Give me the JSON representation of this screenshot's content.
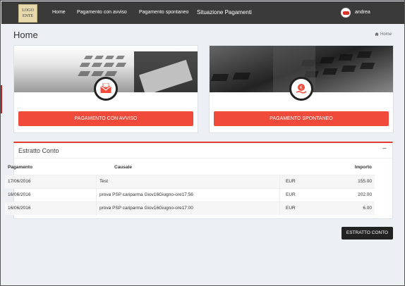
{
  "navbar": {
    "logo_line1": "LOGO",
    "logo_line2": "ENTE",
    "items": [
      {
        "label": "Home"
      },
      {
        "label": "Pagamento con avviso"
      },
      {
        "label": "Pagamento spontaneo"
      },
      {
        "label": "Situazione Pagamenti"
      }
    ],
    "user": "andrea"
  },
  "header": {
    "title": "Home",
    "breadcrumb": "Home"
  },
  "cards": [
    {
      "button_label": "PAGAMENTO CON AVVISO",
      "icon": "envelope-icon"
    },
    {
      "button_label": "PAGAMENTO SPONTANEO",
      "icon": "euro-hand-icon"
    }
  ],
  "estratto": {
    "title": "Estratto Conto",
    "collapse": "−",
    "columns": [
      "Pagamento",
      "Causale",
      "Importo"
    ],
    "rows": [
      {
        "date": "17/06/2016",
        "causale": "Test",
        "currency": "EUR",
        "amount": "155.00"
      },
      {
        "date": "16/06/2016",
        "causale": "prova PSP cariparma Giov16Giugno-ore17:56",
        "currency": "EUR",
        "amount": "202.00"
      },
      {
        "date": "16/06/2016",
        "causale": "prova PSP cariparma Giov16Giugno-ore17:00",
        "currency": "EUR",
        "amount": "6.00"
      }
    ],
    "button_label": "ESTRATTO CONTO"
  },
  "colors": {
    "accent": "#f04a3a",
    "navbar": "#3a3a3a",
    "background": "#ecf0f5"
  }
}
